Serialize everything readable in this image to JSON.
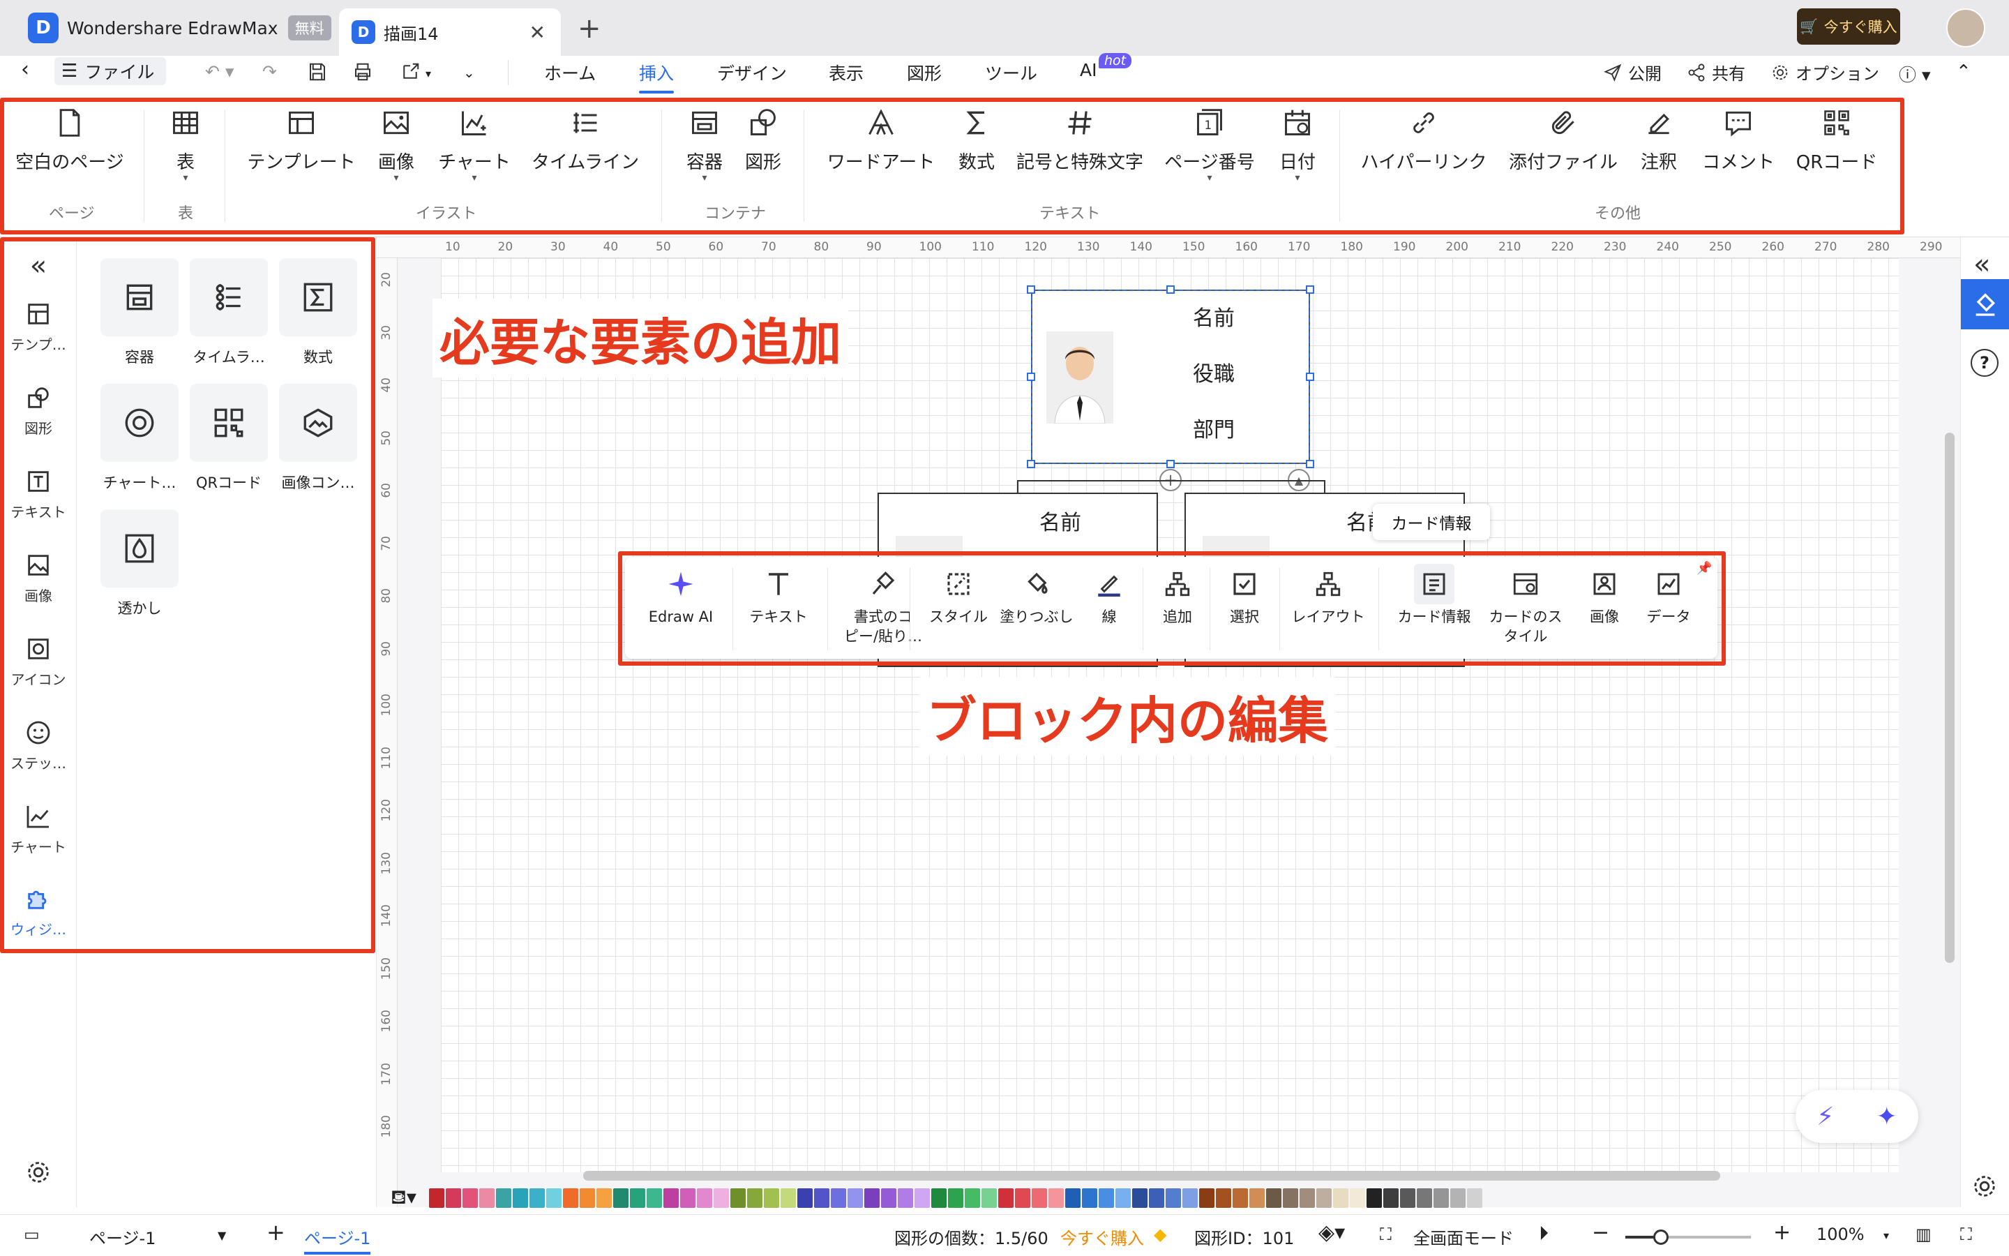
{
  "titlebar": {
    "app_name": "Wondershare EdrawMax",
    "free_badge": "無料",
    "doc_tab": "描画14",
    "close": "✕",
    "new_tab": "+",
    "buy": "今すぐ購入"
  },
  "menubar": {
    "file": "ファイル",
    "tabs": [
      "ホーム",
      "挿入",
      "デザイン",
      "表示",
      "図形",
      "ツール",
      "AI"
    ],
    "active_tab": "挿入",
    "hot": "hot",
    "publish": "公開",
    "share": "共有",
    "options": "オプション"
  },
  "ribbon": {
    "buttons": [
      {
        "label": "空白のページ",
        "icon": "blank-page-icon"
      },
      {
        "label": "表",
        "icon": "table-icon"
      },
      {
        "label": "テンプレート",
        "icon": "template-icon"
      },
      {
        "label": "画像",
        "icon": "image-icon"
      },
      {
        "label": "チャート",
        "icon": "chart-icon"
      },
      {
        "label": "タイムライン",
        "icon": "timeline-icon"
      },
      {
        "label": "容器",
        "icon": "container-icon"
      },
      {
        "label": "図形",
        "icon": "shapes-icon"
      },
      {
        "label": "ワードアート",
        "icon": "wordart-icon"
      },
      {
        "label": "数式",
        "icon": "formula-icon"
      },
      {
        "label": "記号と特殊文字",
        "icon": "symbol-icon"
      },
      {
        "label": "ページ番号",
        "icon": "page-number-icon"
      },
      {
        "label": "日付",
        "icon": "date-icon"
      },
      {
        "label": "ハイパーリンク",
        "icon": "hyperlink-icon"
      },
      {
        "label": "添付ファイル",
        "icon": "attachment-icon"
      },
      {
        "label": "注釈",
        "icon": "annotation-icon"
      },
      {
        "label": "コメント",
        "icon": "comment-icon"
      },
      {
        "label": "QRコード",
        "icon": "qr-code-icon"
      }
    ],
    "groups": [
      "ページ",
      "表",
      "イラスト",
      "コンテナ",
      "テキスト",
      "その他"
    ]
  },
  "leftnav": {
    "items": [
      "テンプ…",
      "図形",
      "テキスト",
      "画像",
      "アイコン",
      "ステッ…",
      "チャート",
      "ウィジ…"
    ],
    "active": "ウィジ…"
  },
  "widgets": [
    "容器",
    "タイムラ…",
    "数式",
    "チャート…",
    "QRコード",
    "画像コン…",
    "透かし"
  ],
  "ruler": {
    "h": [
      "10",
      "20",
      "30",
      "40",
      "50",
      "60",
      "70",
      "80",
      "90",
      "100",
      "110",
      "120",
      "130",
      "140",
      "150",
      "160",
      "170",
      "180",
      "190",
      "200",
      "210",
      "220",
      "230",
      "240",
      "250",
      "260",
      "270",
      "280",
      "290"
    ],
    "v": [
      "20",
      "30",
      "40",
      "50",
      "60",
      "70",
      "80",
      "90",
      "100",
      "110",
      "120",
      "130",
      "140",
      "150",
      "160",
      "170",
      "180"
    ]
  },
  "card_main": {
    "name": "名前",
    "title": "役職",
    "dept": "部門"
  },
  "card_sub": {
    "name1": "名前",
    "name2": "名前"
  },
  "annotations": {
    "add": "必要な要素の追加",
    "edit": "ブロック内の編集"
  },
  "tooltip": "カード情報",
  "floatbar": [
    {
      "label": "Edraw AI",
      "icon": "sparkle-icon"
    },
    {
      "label": "テキスト",
      "icon": "text-icon"
    },
    {
      "label": "書式のコ\nピー/貼り…",
      "icon": "format-painter-icon"
    },
    {
      "label": "スタイル",
      "icon": "style-icon"
    },
    {
      "label": "塗りつぶし",
      "icon": "fill-icon"
    },
    {
      "label": "線",
      "icon": "line-icon"
    },
    {
      "label": "追加",
      "icon": "add-node-icon"
    },
    {
      "label": "選択",
      "icon": "select-icon"
    },
    {
      "label": "レイアウト",
      "icon": "layout-icon"
    },
    {
      "label": "カード情報",
      "icon": "card-info-icon"
    },
    {
      "label": "カードのス\nタイル",
      "icon": "card-style-icon"
    },
    {
      "label": "画像",
      "icon": "card-image-icon"
    },
    {
      "label": "データ",
      "icon": "data-icon"
    }
  ],
  "palette": [
    "#c1272d",
    "#d63a5a",
    "#e2537a",
    "#ec8aa3",
    "#3aa3a3",
    "#29a3b8",
    "#3bb0c9",
    "#6fd0e0",
    "#f06a2a",
    "#f28a2f",
    "#f5a142",
    "#1f8a70",
    "#27a37c",
    "#3cb88e",
    "#bd3fa0",
    "#d05fba",
    "#e388cf",
    "#f0b0df",
    "#6f8f2a",
    "#86a83a",
    "#a1c04f",
    "#c3da7c",
    "#3b3fb0",
    "#5254c9",
    "#6d6fe0",
    "#9193ef",
    "#7a3fbe",
    "#955bd6",
    "#b07ce6",
    "#cfa6f1",
    "#1e8a3c",
    "#2ea34e",
    "#45bb66",
    "#77d291",
    "#d0303a",
    "#e04852",
    "#ee6a72",
    "#f5959b",
    "#1f5fb5",
    "#2d74cf",
    "#4a8ee3",
    "#78aff0",
    "#2b4b9b",
    "#3b60b5",
    "#557dcf",
    "#7d9fe3",
    "#8a3c12",
    "#a3521f",
    "#bb6a33",
    "#d28c55",
    "#6b5a46",
    "#857260",
    "#a08d7b",
    "#bdaea0",
    "#e8dcc0",
    "#f2ead6",
    "#222222",
    "#3d3d3d",
    "#595959",
    "#777777",
    "#959595",
    "#b3b3b3",
    "#d1d1d1"
  ],
  "status": {
    "page_select": "ページ-1",
    "page_tab": "ページ-1",
    "shape_count": "図形の個数：1.5/60",
    "buy_now": "今すぐ購入",
    "shape_id": "図形ID：101",
    "fullscreen": "全画面モード",
    "zoom": "100%"
  }
}
